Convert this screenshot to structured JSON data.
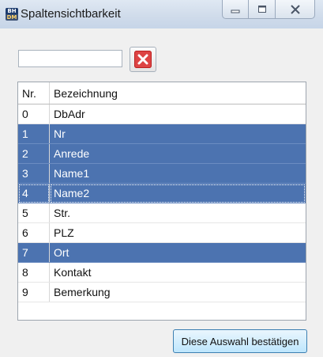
{
  "window": {
    "title": "Spaltensichtbarkeit",
    "icon": "app-icon",
    "icon_text_top": "BH",
    "icon_text_bottom": "DM"
  },
  "filter": {
    "value": "",
    "placeholder": ""
  },
  "clear_button": {
    "icon": "red-x-icon"
  },
  "grid": {
    "columns": [
      "Nr.",
      "Bezeichnung"
    ],
    "rows": [
      {
        "nr": "0",
        "name": "DbAdr",
        "selected": false
      },
      {
        "nr": "1",
        "name": "Nr",
        "selected": true
      },
      {
        "nr": "2",
        "name": "Anrede",
        "selected": true
      },
      {
        "nr": "3",
        "name": "Name1",
        "selected": true
      },
      {
        "nr": "4",
        "name": "Name2",
        "selected": true,
        "focused": true
      },
      {
        "nr": "5",
        "name": "Str.",
        "selected": false
      },
      {
        "nr": "6",
        "name": "PLZ",
        "selected": false
      },
      {
        "nr": "7",
        "name": "Ort",
        "selected": true
      },
      {
        "nr": "8",
        "name": "Kontakt",
        "selected": false
      },
      {
        "nr": "9",
        "name": "Bemerkung",
        "selected": false
      }
    ]
  },
  "confirm_button": {
    "label": "Diese Auswahl bestätigen"
  },
  "colors": {
    "selection": "#4c73b0",
    "clear_icon": "#d44444"
  }
}
